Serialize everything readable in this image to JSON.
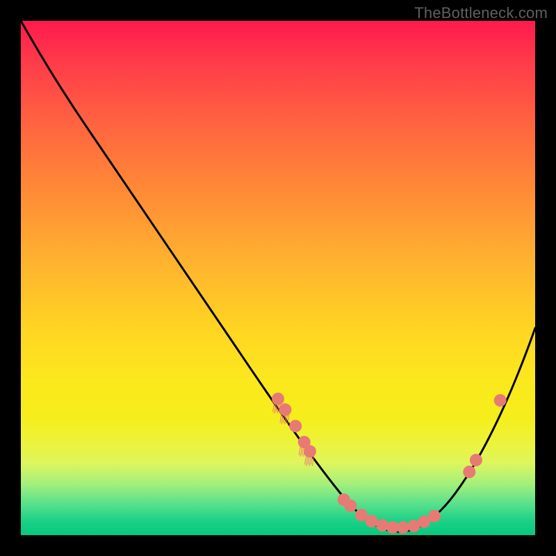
{
  "watermark": "TheBottleneck.com",
  "colors": {
    "gradient_top": "#ff1a4d",
    "gradient_mid": "#ffd522",
    "gradient_bottom": "#04c97e",
    "curve": "#000000",
    "marker": "#e77a74",
    "frame": "#000000"
  },
  "chart_data": {
    "type": "line",
    "title": "",
    "xlabel": "",
    "ylabel": "",
    "xlim": [
      0,
      100
    ],
    "ylim": [
      0,
      100
    ],
    "grid": false,
    "legend": false,
    "note": "Values estimated from pixel positions; y increases upward (0 = bottom green band, 100 = top red).",
    "series": [
      {
        "name": "curve",
        "x": [
          0,
          3,
          8,
          14,
          20,
          26,
          32,
          38,
          44,
          50,
          55,
          60,
          65,
          70,
          75,
          80,
          84,
          88,
          92,
          96,
          100
        ],
        "y": [
          100,
          96,
          89,
          80,
          71,
          62,
          53,
          44,
          35,
          26,
          18,
          11,
          5,
          2,
          1,
          2,
          6,
          14,
          24,
          36,
          49
        ]
      }
    ],
    "markers": [
      {
        "x": 50.0,
        "y": 26.5,
        "style": "dot-tassel"
      },
      {
        "x": 51.4,
        "y": 24.4,
        "style": "dot-tassel"
      },
      {
        "x": 53.4,
        "y": 21.2,
        "style": "dot"
      },
      {
        "x": 55.1,
        "y": 18.1,
        "style": "dot-tassel"
      },
      {
        "x": 56.2,
        "y": 16.3,
        "style": "dot-tassel"
      },
      {
        "x": 62.8,
        "y": 6.9,
        "style": "dot"
      },
      {
        "x": 64.1,
        "y": 5.7,
        "style": "dot"
      },
      {
        "x": 66.2,
        "y": 3.9,
        "style": "dot"
      },
      {
        "x": 68.2,
        "y": 2.7,
        "style": "dot"
      },
      {
        "x": 70.3,
        "y": 1.9,
        "style": "dot"
      },
      {
        "x": 72.3,
        "y": 1.5,
        "style": "dot"
      },
      {
        "x": 74.3,
        "y": 1.5,
        "style": "dot"
      },
      {
        "x": 76.4,
        "y": 1.8,
        "style": "dot"
      },
      {
        "x": 78.4,
        "y": 2.6,
        "style": "dot"
      },
      {
        "x": 80.4,
        "y": 3.7,
        "style": "dot"
      },
      {
        "x": 87.2,
        "y": 12.3,
        "style": "dot"
      },
      {
        "x": 88.5,
        "y": 14.6,
        "style": "dot"
      },
      {
        "x": 93.2,
        "y": 26.2,
        "style": "dot"
      }
    ]
  }
}
